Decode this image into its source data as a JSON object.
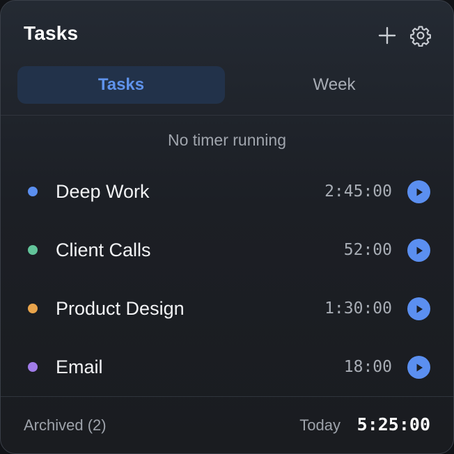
{
  "header": {
    "title": "Tasks",
    "add_icon": "plus-icon",
    "settings_icon": "gear-icon"
  },
  "tabs": [
    {
      "label": "Tasks",
      "active": true
    },
    {
      "label": "Week",
      "active": false
    }
  ],
  "status_text": "No timer running",
  "tasks": [
    {
      "name": "Deep Work",
      "time": "2:45:00",
      "color": "#5b8ff0"
    },
    {
      "name": "Client Calls",
      "time": "52:00",
      "color": "#62c49a"
    },
    {
      "name": "Product Design",
      "time": "1:30:00",
      "color": "#e9a44b"
    },
    {
      "name": "Email",
      "time": "18:00",
      "color": "#a07be8"
    }
  ],
  "footer": {
    "archived_label": "Archived (2)",
    "today_label": "Today",
    "today_total": "5:25:00"
  },
  "colors": {
    "accent": "#5b8ff0",
    "active_tab_bg": "#22324a",
    "background": "#1c1f25"
  }
}
